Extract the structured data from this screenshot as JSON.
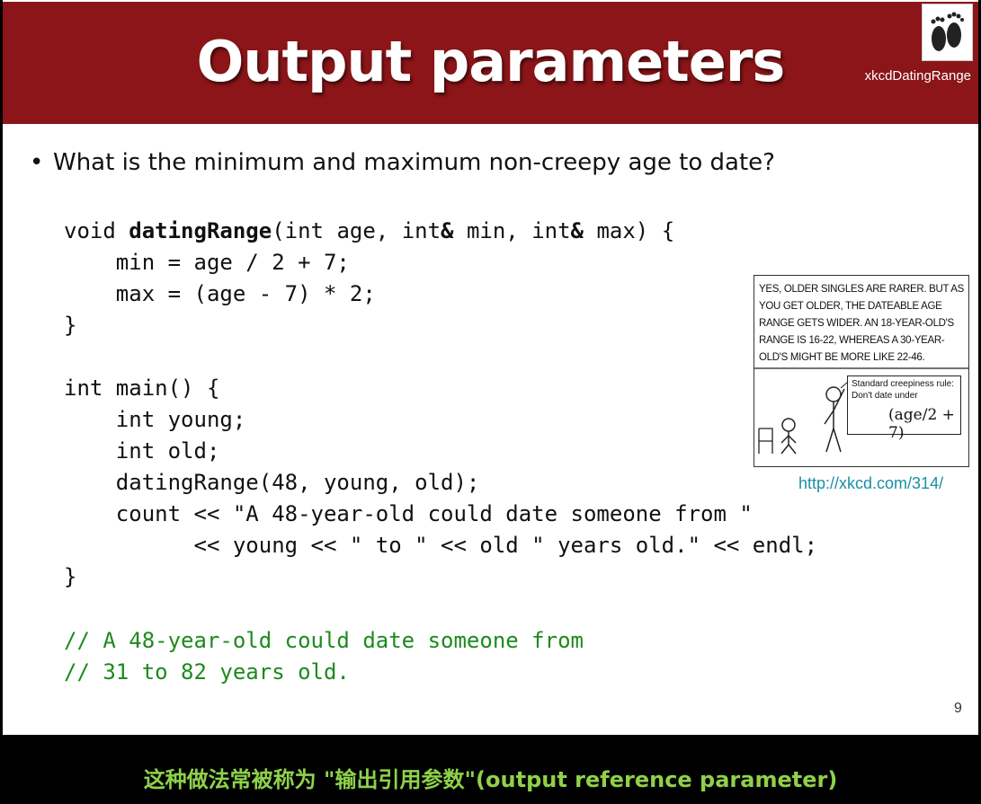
{
  "slide": {
    "title": "Output parameters",
    "logo_caption": "xkcdDatingRange",
    "bullet": "What is the minimum and maximum non-creepy age to date?",
    "page_number": "9",
    "colors": {
      "title_bar": "#8b1518",
      "comment": "#1d8a1d",
      "link": "#1a8fa5",
      "subtitle": "#8fd14a"
    }
  },
  "code": {
    "fn_kw": "void ",
    "fn_name": "datingRange",
    "fn_params": "(int age, int",
    "amp1": "&",
    "min_param": " min, int",
    "amp2": "&",
    "max_param": " max) {",
    "lines": [
      "    min = age / 2 + 7;",
      "    max = (age - 7) * 2;",
      "}",
      "",
      "int main() {",
      "    int young;",
      "    int old;",
      "    datingRange(48, young, old);",
      "    count << \"A 48-year-old could date someone from \"",
      "          << young << \" to \" << old \" years old.\" << endl;",
      "}"
    ],
    "comments": [
      "// A 48-year-old could date someone from",
      "// 31 to 82 years old."
    ]
  },
  "comic": {
    "caption": "Yes, older singles are rarer. But as you get older, the dateable age range gets wider. An 18-year-old's range is 16-22, whereas a 30-year-old's might be more like 22-46.",
    "rule": "Standard creepiness rule: Don't date under",
    "formula": "(age/2 + 7)",
    "link": "http://xkcd.com/314/"
  },
  "subtitle": "这种做法常被称为 \"输出引用参数\"(output reference parameter)"
}
